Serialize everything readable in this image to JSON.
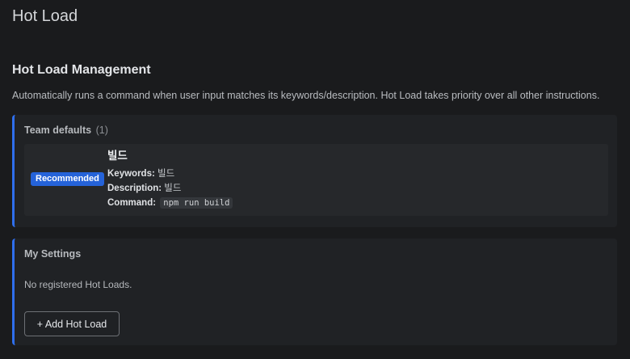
{
  "page": {
    "title": "Hot Load"
  },
  "management": {
    "title": "Hot Load Management",
    "description": "Automatically runs a command when user input matches its keywords/description. Hot Load takes priority over all other instructions."
  },
  "team_defaults": {
    "heading": "Team defaults",
    "count": "(1)",
    "entries": [
      {
        "badge": "Recommended",
        "name": "빌드",
        "keywords_label": "Keywords:",
        "keywords": "빌드",
        "description_label": "Description:",
        "description": "빌드",
        "command_label": "Command:",
        "command": "npm run build"
      }
    ]
  },
  "my_settings": {
    "heading": "My Settings",
    "empty_text": "No registered Hot Loads.",
    "add_button_label": "+ Add Hot Load"
  },
  "colors": {
    "background": "#1a1b1d",
    "panel": "#202225",
    "accent": "#2f6fed",
    "badge": "#2563d9"
  }
}
